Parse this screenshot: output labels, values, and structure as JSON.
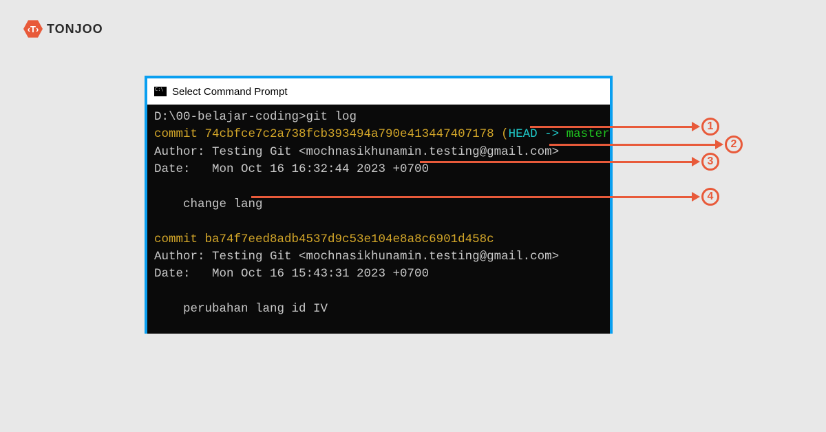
{
  "brand": {
    "glyph": "‹T›",
    "name": "TONJOO"
  },
  "window": {
    "title": "Select Command Prompt"
  },
  "terminal": {
    "prompt": "D:\\00-belajar-coding>",
    "command": "git log",
    "commit1": {
      "label": "commit ",
      "hash": "74cbfce7c2a738fcb393494a790e413447407178",
      "ref_open": " (",
      "ref_head": "HEAD -> ",
      "ref_branch": "master",
      "ref_close": ")",
      "author": "Author: Testing Git <mochnasikhunamin.testing@gmail.com>",
      "date": "Date:   Mon Oct 16 16:32:44 2023 +0700",
      "message": "    change lang"
    },
    "commit2": {
      "label": "commit ",
      "hash": "ba74f7eed8adb4537d9c53e104e8a8c6901d458c",
      "author": "Author: Testing Git <mochnasikhunamin.testing@gmail.com>",
      "date": "Date:   Mon Oct 16 15:43:31 2023 +0700",
      "message": "    perubahan lang id IV"
    }
  },
  "annotations": {
    "n1": "1",
    "n2": "2",
    "n3": "3",
    "n4": "4"
  }
}
